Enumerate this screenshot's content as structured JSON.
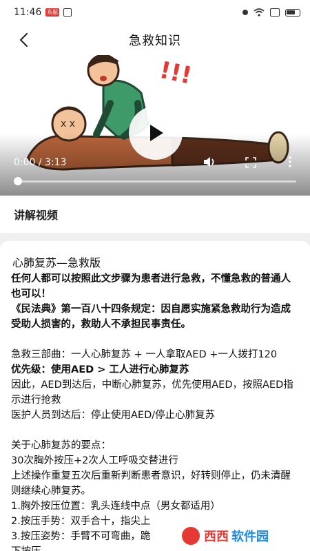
{
  "status_bar": {
    "time": "11:46",
    "badge": "东航"
  },
  "nav": {
    "title": "急救知识"
  },
  "video": {
    "time_display": "0:00 / 3:13",
    "progress": 0,
    "illustration_text": "!!!"
  },
  "section": {
    "title": "讲解视频"
  },
  "article": {
    "heading": "心肺复苏—急救版",
    "lines": {
      "l1": "任何人都可以按照此文步骤为患者进行急救，不懂急救的普通人也可以！",
      "l2": "《民法典》第一百八十四条规定：因自愿实施紧急救助行为造成受助人损害的，救助人不承担民事责任。",
      "l3": "急救三部曲：一人心肺复苏 + 一人拿取AED +一人拨打120",
      "l4": "优先级：使用AED > 工人进行心肺复苏",
      "l5": "因此，AED到达后，中断心肺复苏，优先使用AED，按照AED指示进行抢救",
      "l6": "医护人员到达后：停止使用AED/停止心肺复苏",
      "l7": "关于心肺复苏的要点：",
      "l8": "30次胸外按压+2次人工呼吸交替进行",
      "l9": "上述操作重复五次后重新判断患者意识，好转则停止，仍未清醒则继续心肺复苏。",
      "l10": "1.胸外按压位置：乳头连线中点（男女都适用）",
      "l11": "2.按压手势：双手合十，指尖上",
      "l12": "3.按压姿势：手臂不可弯曲，跪",
      "l13": "下按压"
    }
  },
  "watermark": {
    "main": "西西",
    "sub": "软件园",
    "url": "CR173.COM"
  },
  "colors": {
    "accent_red": "#e53935",
    "watermark_blue": "#1e88e5"
  }
}
